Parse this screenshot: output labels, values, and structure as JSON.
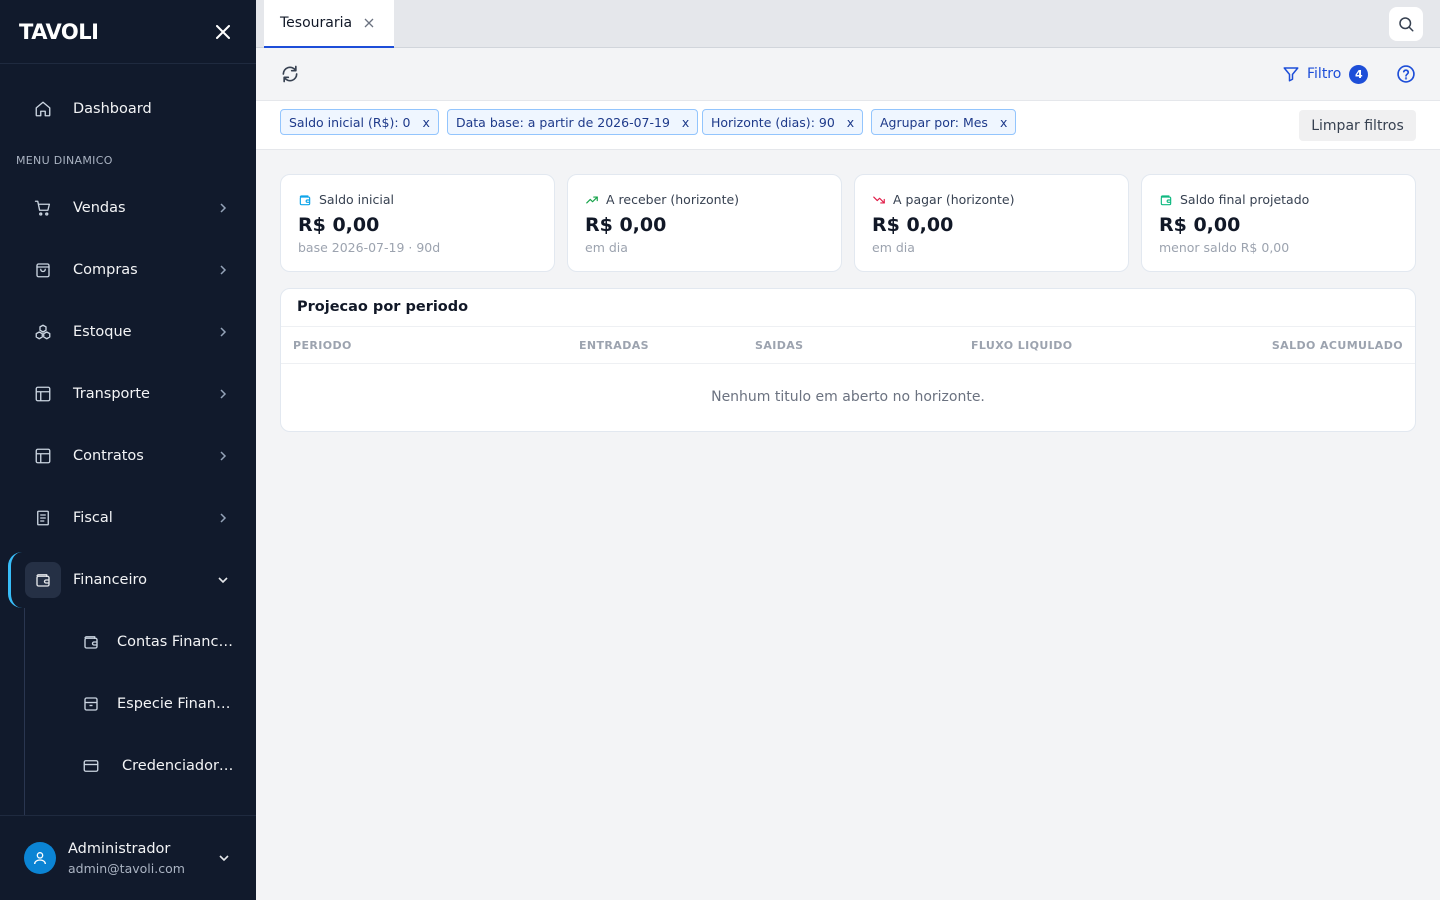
{
  "sidebar": {
    "logo": "TAVOLI",
    "section_title": "MENU DINAMICO",
    "dashboard": "Dashboard",
    "items": [
      {
        "label": "Vendas",
        "icon": "cart-icon"
      },
      {
        "label": "Compras",
        "icon": "shopping-bag-icon"
      },
      {
        "label": "Estoque",
        "icon": "boxes-icon"
      },
      {
        "label": "Transporte",
        "icon": "layout-icon"
      },
      {
        "label": "Contratos",
        "icon": "layout-icon"
      },
      {
        "label": "Fiscal",
        "icon": "receipt-icon"
      },
      {
        "label": "Financeiro",
        "icon": "wallet-icon"
      }
    ],
    "sub_items": [
      {
        "label": "Contas Financ…",
        "icon": "wallet-icon"
      },
      {
        "label": "Especie Finan…",
        "icon": "archive-icon"
      },
      {
        "label": "Credenciador…",
        "icon": "credit-card-icon"
      }
    ],
    "user": {
      "name": "Administrador",
      "email": "admin@tavoli.com"
    }
  },
  "tabs": [
    {
      "label": "Tesouraria"
    }
  ],
  "toolbar": {
    "filter_label": "Filtro",
    "filter_count": "4"
  },
  "filters": {
    "chips": [
      {
        "label": "Saldo inicial (R$): 0"
      },
      {
        "label": "Data base: a partir de 2026-07-19"
      },
      {
        "label": "Horizonte (dias): 90"
      },
      {
        "label": "Agrupar por: Mes"
      }
    ],
    "remove_glyph": "x",
    "clear_label": "Limpar filtros"
  },
  "cards": [
    {
      "label": "Saldo inicial",
      "value": "R$ 0,00",
      "sub": "base 2026-07-19 · 90d",
      "icon": "wallet-icon",
      "color": "#0ea5e9"
    },
    {
      "label": "A receber (horizonte)",
      "value": "R$ 0,00",
      "sub": "em dia",
      "icon": "trending-up-icon",
      "color": "#16a34a"
    },
    {
      "label": "A pagar (horizonte)",
      "value": "R$ 0,00",
      "sub": "em dia",
      "icon": "trending-down-icon",
      "color": "#e11d48"
    },
    {
      "label": "Saldo final projetado",
      "value": "R$ 0,00",
      "sub": "menor saldo R$ 0,00",
      "icon": "wallet-icon",
      "color": "#10b981"
    }
  ],
  "projection": {
    "title": "Projecao por periodo",
    "columns": [
      "PERIODO",
      "ENTRADAS",
      "SAIDAS",
      "FLUXO LIQUIDO",
      "SALDO ACUMULADO"
    ],
    "empty_message": "Nenhum titulo em aberto no horizonte."
  },
  "colors": {
    "sidebar_bg": "#111a2c",
    "accent": "#1d4ed8",
    "active_border": "#38bdf8"
  }
}
